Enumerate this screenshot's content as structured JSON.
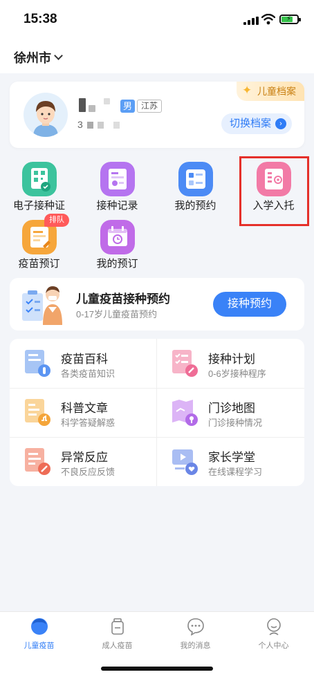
{
  "status_bar": {
    "time": "15:38"
  },
  "top_bar": {
    "city": "徐州市"
  },
  "profile": {
    "gender": "男",
    "province": "江苏",
    "id_prefix": "3",
    "archive_tag": "儿童档案",
    "switch_button": "切换档案"
  },
  "quick_grid": [
    {
      "label": "电子接种证",
      "icon": "vaccine-certificate-icon"
    },
    {
      "label": "接种记录",
      "icon": "vaccination-record-icon"
    },
    {
      "label": "我的预约",
      "icon": "my-appointment-icon"
    },
    {
      "label": "入学入托",
      "icon": "school-enrollment-icon"
    },
    {
      "label": "疫苗预订",
      "icon": "vaccine-booking-icon",
      "badge": "排队"
    },
    {
      "label": "我的预订",
      "icon": "my-booking-icon"
    }
  ],
  "booking_card": {
    "title": "儿童疫苗接种预约",
    "subtitle": "0-17岁儿童疫苗预约",
    "button": "接种预约"
  },
  "services": [
    {
      "title": "疫苗百科",
      "subtitle": "各类疫苗知识",
      "icon": "vaccine-encyclopedia-icon"
    },
    {
      "title": "接种计划",
      "subtitle": "0-6岁接种程序",
      "icon": "vaccination-plan-icon"
    },
    {
      "title": "科普文章",
      "subtitle": "科学答疑解惑",
      "icon": "science-article-icon"
    },
    {
      "title": "门诊地图",
      "subtitle": "门诊接种情况",
      "icon": "clinic-map-icon"
    },
    {
      "title": "异常反应",
      "subtitle": "不良反应反馈",
      "icon": "adverse-reaction-icon"
    },
    {
      "title": "家长学堂",
      "subtitle": "在线课程学习",
      "icon": "parent-school-icon"
    }
  ],
  "tabs": [
    {
      "label": "儿童疫苗",
      "active": true
    },
    {
      "label": "成人疫苗",
      "active": false
    },
    {
      "label": "我的消息",
      "active": false
    },
    {
      "label": "个人中心",
      "active": false
    }
  ],
  "colors": {
    "accent": "#2f7cf6",
    "highlight_border": "#e5302a",
    "badge_red": "#ff5a5a",
    "archive_gold": "#c98114"
  }
}
